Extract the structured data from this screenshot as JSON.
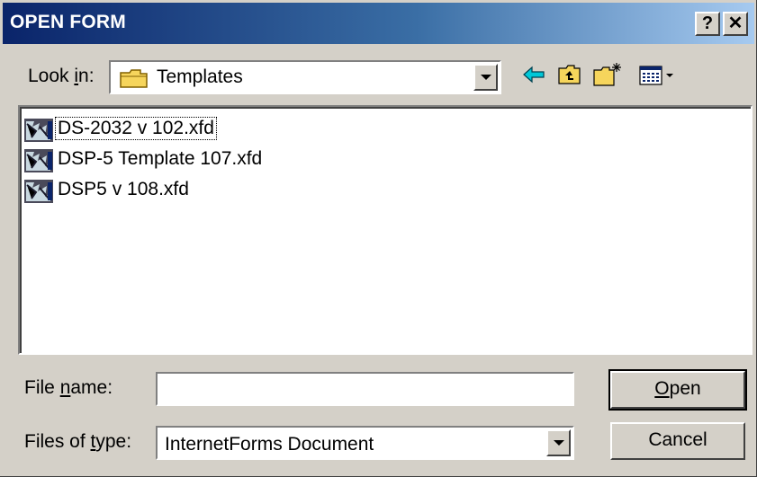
{
  "window": {
    "title": "OPEN FORM",
    "help_label": "?",
    "close_label": "✕"
  },
  "look_in": {
    "label_pre": "Look ",
    "label_mnemonic": "i",
    "label_post": "n:",
    "value": "Templates"
  },
  "toolbar": {
    "icons": [
      "back-arrow-icon",
      "up-one-level-icon",
      "new-folder-icon",
      "view-menu-icon"
    ]
  },
  "files": [
    {
      "name": "DS-2032 v 102.xfd",
      "icon": "xfd-file-icon"
    },
    {
      "name": "DSP-5 Template 107.xfd",
      "icon": "xfd-file-icon"
    },
    {
      "name": "DSP5 v 108.xfd",
      "icon": "xfd-file-icon"
    }
  ],
  "file_name": {
    "label_pre": "File ",
    "label_mnemonic": "n",
    "label_post": "ame:",
    "value": ""
  },
  "file_type": {
    "label_pre": "Files of ",
    "label_mnemonic": "t",
    "label_post": "ype:",
    "value": "InternetForms Document"
  },
  "buttons": {
    "open_mnemonic": "O",
    "open_rest": "pen",
    "cancel": "Cancel"
  },
  "colors": {
    "title_gradient_start": "#0a246a",
    "title_gradient_end": "#a6caf0",
    "face": "#d4d0c8",
    "back_arrow": "#00c8d8"
  }
}
